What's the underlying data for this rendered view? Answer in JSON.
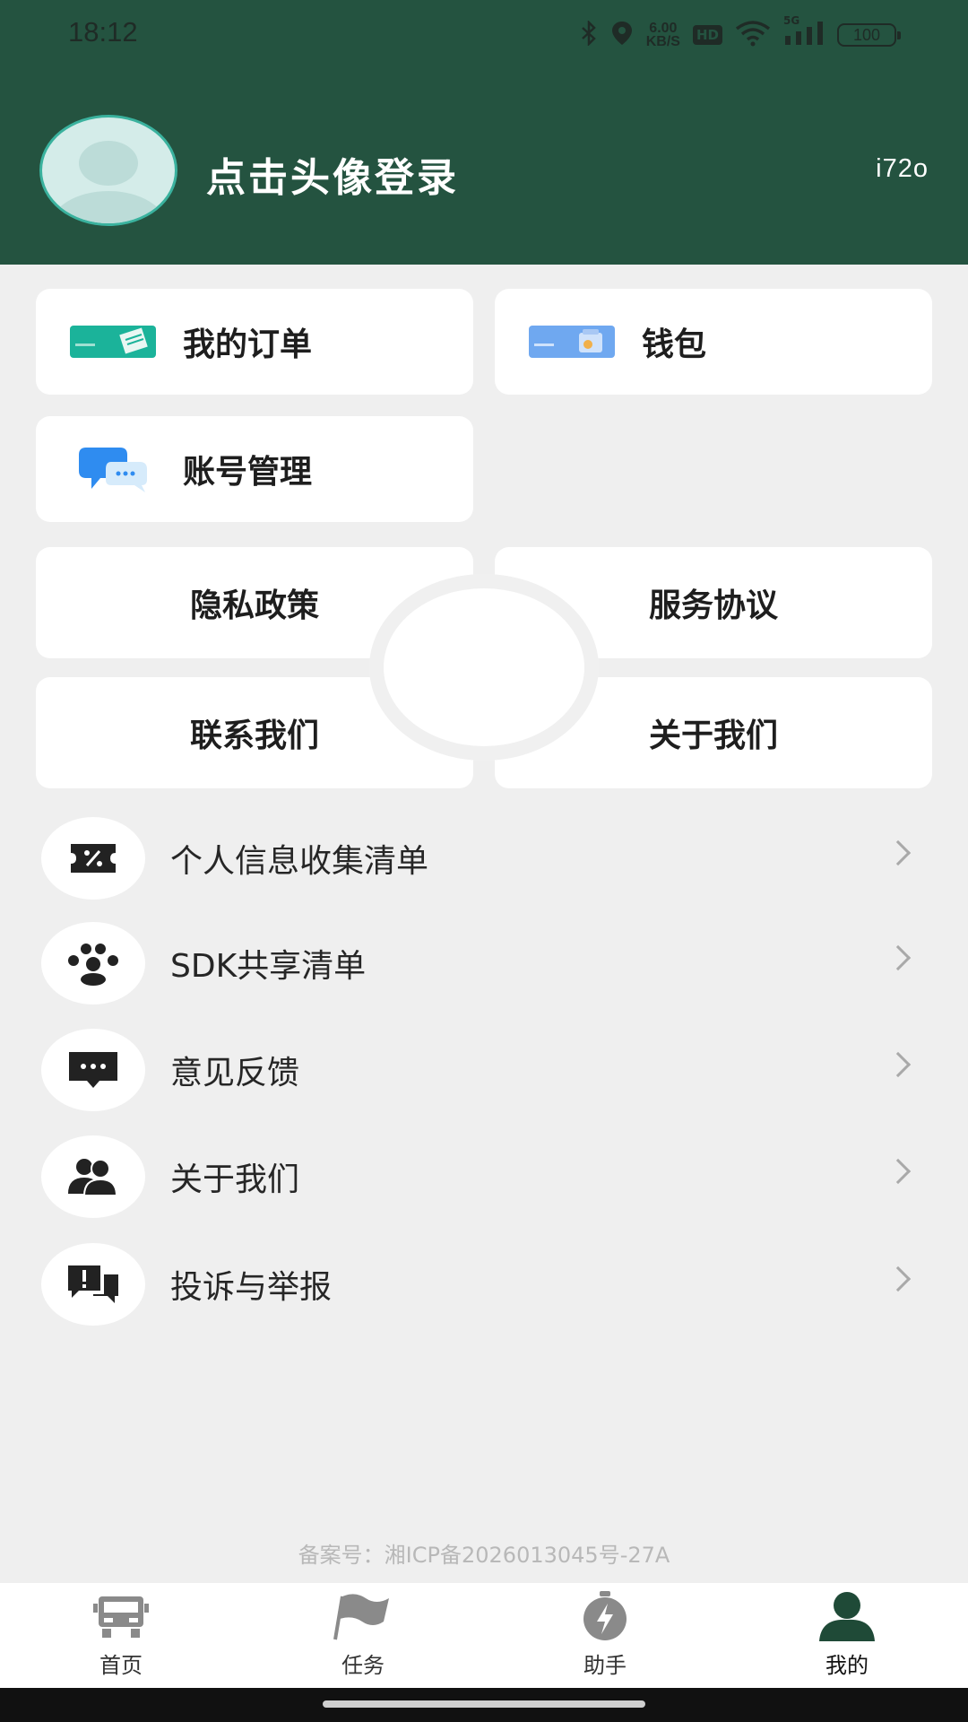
{
  "status_bar": {
    "time": "18:12",
    "net_speed_value": "6.00",
    "net_speed_unit": "KB/S",
    "hd_badge": "HD",
    "battery": "100",
    "signal_badge": "5G"
  },
  "profile": {
    "login_prompt": "点击头像登录",
    "user_id": "i72o"
  },
  "top_cards": [
    {
      "label": "我的订单",
      "icon": "order-card-icon",
      "color": "#1bb39a"
    },
    {
      "label": "钱包",
      "icon": "wallet-card-icon",
      "color": "#6fa8f0"
    },
    {
      "label": "账号管理",
      "icon": "chat-bubbles-icon",
      "color": "#2f8cf0"
    }
  ],
  "link_cards": [
    {
      "label": "隐私政策"
    },
    {
      "label": "服务协议"
    },
    {
      "label": "联系我们"
    },
    {
      "label": "关于我们"
    }
  ],
  "list_items": [
    {
      "label": "个人信息收集清单",
      "icon": "ticket-percent-icon"
    },
    {
      "label": "SDK共享清单",
      "icon": "group-icon"
    },
    {
      "label": "意见反馈",
      "icon": "message-dots-icon"
    },
    {
      "label": "关于我们",
      "icon": "users-icon"
    },
    {
      "label": "投诉与举报",
      "icon": "report-icon"
    }
  ],
  "footer": {
    "icp": "备案号：湘ICP备2026013045号-27A"
  },
  "tabbar": {
    "tabs": [
      {
        "label": "首页",
        "icon": "truck-icon",
        "active": false
      },
      {
        "label": "任务",
        "icon": "flag-icon",
        "active": false
      },
      {
        "label": "助手",
        "icon": "lightning-icon",
        "active": false
      },
      {
        "label": "我的",
        "icon": "person-icon",
        "active": true
      }
    ]
  },
  "colors": {
    "header_bg": "#245340",
    "page_bg": "#efefef",
    "active_tab": "#1f4a37"
  }
}
